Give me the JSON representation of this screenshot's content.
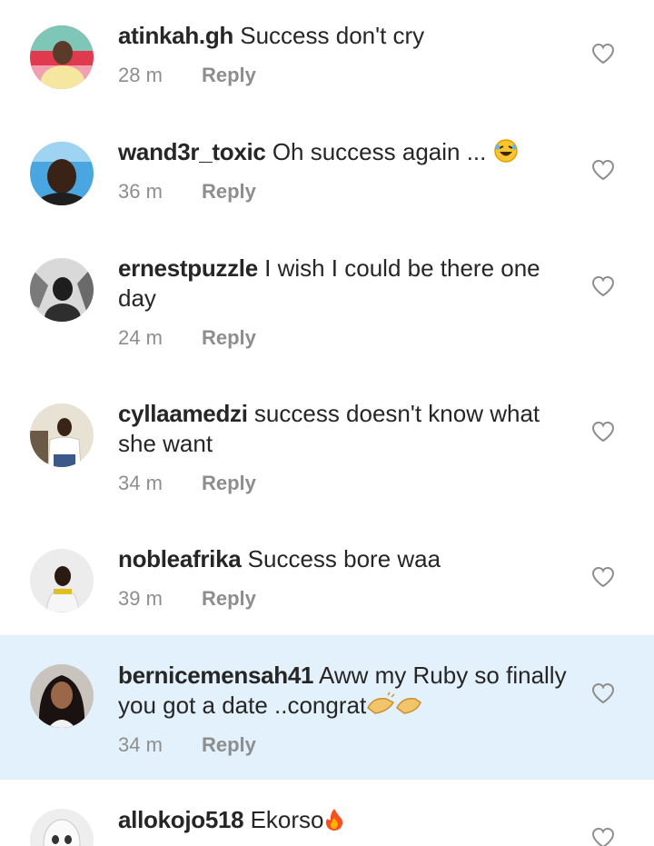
{
  "comments": [
    {
      "username": "atinkah.gh",
      "text": "Success don't cry",
      "time": "28 m",
      "reply": "Reply"
    },
    {
      "username": "wand3r_toxic",
      "text": "Oh success again ...",
      "emoji": "rofl-emoji",
      "time": "36 m",
      "reply": "Reply"
    },
    {
      "username": "ernestpuzzle",
      "text": "I wish I could be there one day",
      "time": "24 m",
      "reply": "Reply"
    },
    {
      "username": "cyllaamedzi",
      "text": "success doesn't know what she want",
      "time": "34 m",
      "reply": "Reply"
    },
    {
      "username": "nobleafrika",
      "text": "Success bore waa",
      "time": "39 m",
      "reply": "Reply"
    },
    {
      "username": "bernicemensah41",
      "text": "Aww my Ruby so finally you got a date ..congrat",
      "emoji": "clapping-hands-emoji",
      "time": "34 m",
      "reply": "Reply",
      "highlighted": true
    },
    {
      "username": "allokojo518",
      "text": "Ekorso",
      "emoji": "fire-emoji",
      "time": "",
      "reply": ""
    }
  ],
  "colors": {
    "highlight_background": "#e3f1fc",
    "text": "#262626",
    "secondary_text": "#8e8e8e",
    "icon": "#8e8e8e"
  }
}
